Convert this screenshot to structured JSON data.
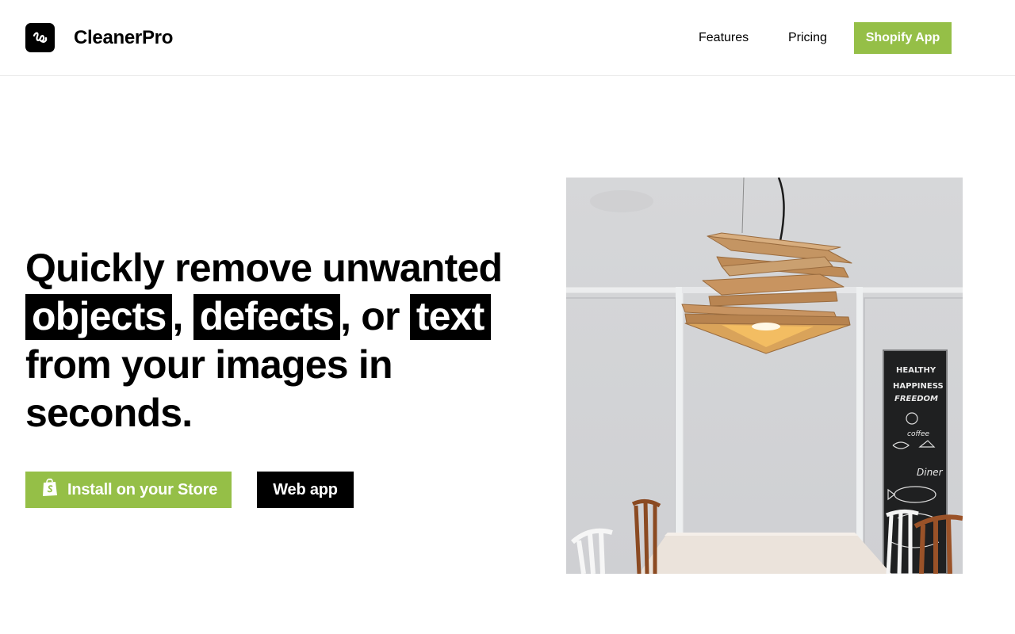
{
  "colors": {
    "accent": "#95bf47",
    "text": "#000000",
    "background": "#ffffff"
  },
  "header": {
    "logo_icon": "cleanerpro-logo-icon",
    "brand_name": "CleanerPro",
    "nav": {
      "features": "Features",
      "pricing": "Pricing",
      "shopify_app": "Shopify App"
    }
  },
  "hero": {
    "heading": {
      "part1": "Quickly remove unwanted",
      "highlight1": "objects",
      "sep1": ",",
      "highlight2": "defects",
      "sep2": ", or",
      "highlight3": "text",
      "part2": "from your images in",
      "part3": "seconds."
    },
    "buttons": {
      "install_icon": "shopify-bag-icon",
      "install_label": "Install on your Store",
      "web_app_label": "Web app"
    },
    "image": {
      "subject": "wooden-pendant-lamp-dining-room",
      "chalkboard_lines": [
        "HEALTHY",
        "HAPPINESS",
        "FREEDOM",
        "coffee",
        "Diner"
      ]
    }
  }
}
